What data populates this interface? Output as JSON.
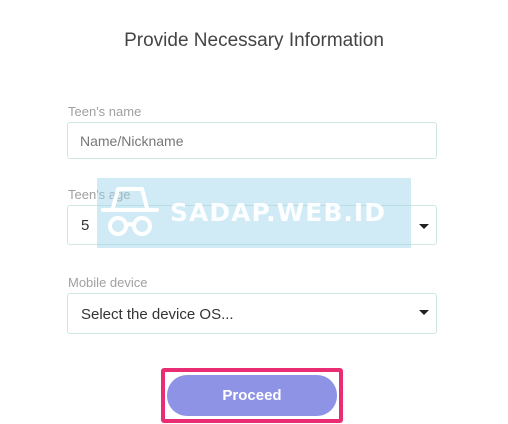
{
  "form": {
    "title": "Provide Necessary Information",
    "name_field": {
      "label": "Teen's name",
      "placeholder": "Name/Nickname",
      "value": ""
    },
    "age_field": {
      "label": "Teen's age",
      "value": "5"
    },
    "device_field": {
      "label": "Mobile device",
      "value": "Select the device OS..."
    },
    "proceed_label": "Proceed"
  },
  "watermark": {
    "text": "SADAP.WEB.ID",
    "icon": "incognito-icon"
  },
  "colors": {
    "button_bg": "#8e93e6",
    "highlight_border": "#ea2d72",
    "field_border": "#cfe8de",
    "watermark_bg": "#96d2e8"
  }
}
